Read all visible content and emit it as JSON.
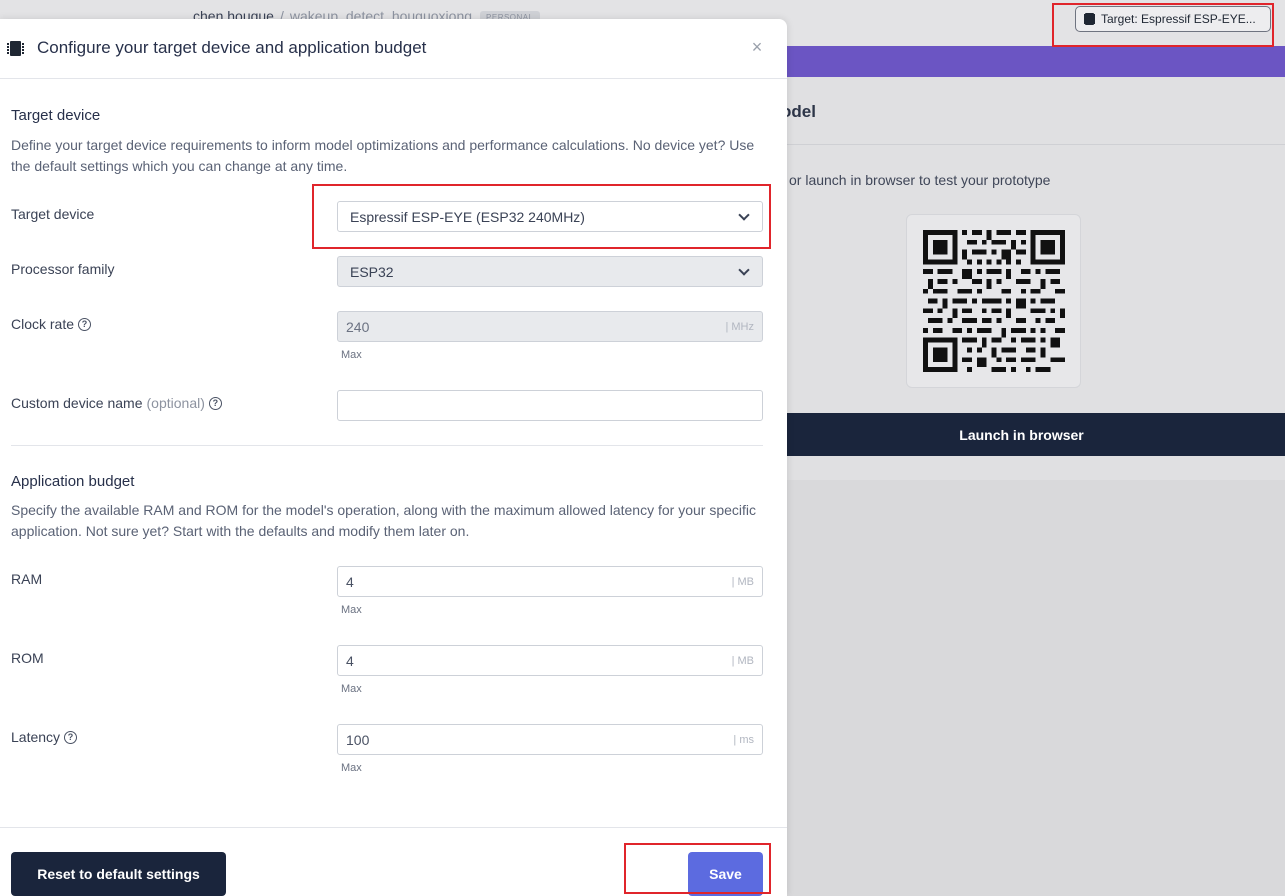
{
  "background": {
    "breadcrumb": {
      "user": "chen houque",
      "separator": "/",
      "project": "wakeup_detect_houguoxiong",
      "badge": "PERSONAL"
    },
    "target_button_label": "Target: Espressif ESP-EYE...",
    "card_title": "odel",
    "card_text": "or launch in browser to test your prototype",
    "launch_button_label": "Launch in browser",
    "accent_color": "#6b55c3"
  },
  "modal": {
    "title": "Configure your target device and application budget",
    "close_label": "×",
    "target_section": {
      "title": "Target device",
      "description": "Define your target device requirements to inform model optimizations and performance calculations. No device yet? Use the default settings which you can change at any time."
    },
    "fields": {
      "target_device": {
        "label": "Target device",
        "value": "Espressif ESP-EYE (ESP32 240MHz)"
      },
      "processor_family": {
        "label": "Processor family",
        "value": "ESP32"
      },
      "clock_rate": {
        "label": "Clock rate",
        "value": "240",
        "unit": "| MHz",
        "hint": "Max"
      },
      "custom_device_name": {
        "label": "Custom device name",
        "optional": "(optional)",
        "value": ""
      },
      "ram": {
        "label": "RAM",
        "value": "4",
        "unit": "| MB",
        "hint": "Max"
      },
      "rom": {
        "label": "ROM",
        "value": "4",
        "unit": "| MB",
        "hint": "Max"
      },
      "latency": {
        "label": "Latency",
        "value": "100",
        "unit": "| ms",
        "hint": "Max"
      }
    },
    "budget_section": {
      "title": "Application budget",
      "description": "Specify the available RAM and ROM for the model's operation, along with the maximum allowed latency for your specific application. Not sure yet? Start with the defaults and modify them later on."
    },
    "reset_button_label": "Reset to default settings",
    "save_button_label": "Save",
    "save_color": "#5c6be0",
    "highlight_color": "#e0252b"
  }
}
